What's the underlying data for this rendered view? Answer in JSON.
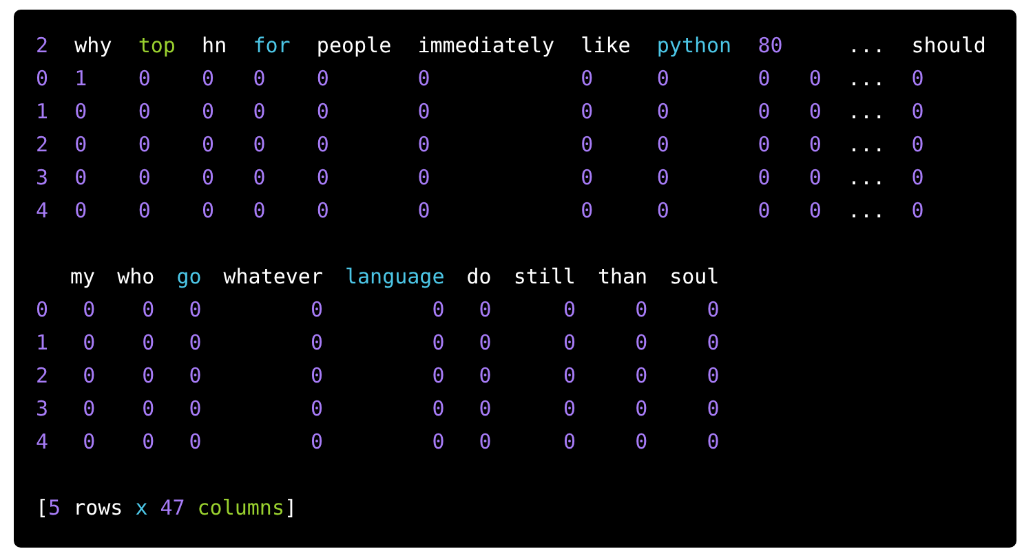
{
  "tables": [
    {
      "headers": [
        {
          "text": "2",
          "color": "#a77cf7"
        },
        {
          "text": "why",
          "color": "#ffffff"
        },
        {
          "text": "top",
          "color": "#9ad12f"
        },
        {
          "text": "hn",
          "color": "#ffffff"
        },
        {
          "text": "for",
          "color": "#4cc6e6"
        },
        {
          "text": "people",
          "color": "#ffffff"
        },
        {
          "text": "immediately",
          "color": "#ffffff"
        },
        {
          "text": "like",
          "color": "#ffffff"
        },
        {
          "text": "python",
          "color": "#4cc6e6"
        },
        {
          "text": "80",
          "color": "#a77cf7"
        },
        {
          "text": "...",
          "color": "#ffffff"
        },
        {
          "text": "should",
          "color": "#ffffff"
        }
      ],
      "rows": [
        {
          "index": "0",
          "values": [
            "1",
            "0",
            "0",
            "0",
            "0",
            "0",
            "0",
            "0",
            "0",
            "0",
            "...",
            "0"
          ]
        },
        {
          "index": "1",
          "values": [
            "0",
            "0",
            "0",
            "0",
            "0",
            "0",
            "0",
            "0",
            "0",
            "0",
            "...",
            "0"
          ]
        },
        {
          "index": "2",
          "values": [
            "0",
            "0",
            "0",
            "0",
            "0",
            "0",
            "0",
            "0",
            "0",
            "0",
            "...",
            "0"
          ]
        },
        {
          "index": "3",
          "values": [
            "0",
            "0",
            "0",
            "0",
            "0",
            "0",
            "0",
            "0",
            "0",
            "0",
            "...",
            "0"
          ]
        },
        {
          "index": "4",
          "values": [
            "0",
            "0",
            "0",
            "0",
            "0",
            "0",
            "0",
            "0",
            "0",
            "0",
            "...",
            "0"
          ]
        }
      ]
    },
    {
      "headers": [
        {
          "text": "my",
          "color": "#ffffff"
        },
        {
          "text": "who",
          "color": "#ffffff"
        },
        {
          "text": "go",
          "color": "#4cc6e6"
        },
        {
          "text": "whatever",
          "color": "#ffffff"
        },
        {
          "text": "language",
          "color": "#4cc6e6"
        },
        {
          "text": "do",
          "color": "#ffffff"
        },
        {
          "text": "still",
          "color": "#ffffff"
        },
        {
          "text": "than",
          "color": "#ffffff"
        },
        {
          "text": "soul",
          "color": "#ffffff"
        }
      ],
      "rows": [
        {
          "index": "0",
          "values": [
            "0",
            "0",
            "0",
            "0",
            "0",
            "0",
            "0",
            "0",
            "0"
          ]
        },
        {
          "index": "1",
          "values": [
            "0",
            "0",
            "0",
            "0",
            "0",
            "0",
            "0",
            "0",
            "0"
          ]
        },
        {
          "index": "2",
          "values": [
            "0",
            "0",
            "0",
            "0",
            "0",
            "0",
            "0",
            "0",
            "0"
          ]
        },
        {
          "index": "3",
          "values": [
            "0",
            "0",
            "0",
            "0",
            "0",
            "0",
            "0",
            "0",
            "0"
          ]
        },
        {
          "index": "4",
          "values": [
            "0",
            "0",
            "0",
            "0",
            "0",
            "0",
            "0",
            "0",
            "0"
          ]
        }
      ]
    }
  ],
  "footer": [
    {
      "text": "[",
      "color": "#ffffff"
    },
    {
      "text": "5",
      "color": "#a77cf7"
    },
    {
      "text": "rows",
      "color": "#ffffff"
    },
    {
      "text": "x",
      "color": "#4cc6e6"
    },
    {
      "text": "47",
      "color": "#a77cf7"
    },
    {
      "text": "columns",
      "color": "#9ad12f"
    },
    {
      "text": "]",
      "color": "#ffffff"
    }
  ]
}
